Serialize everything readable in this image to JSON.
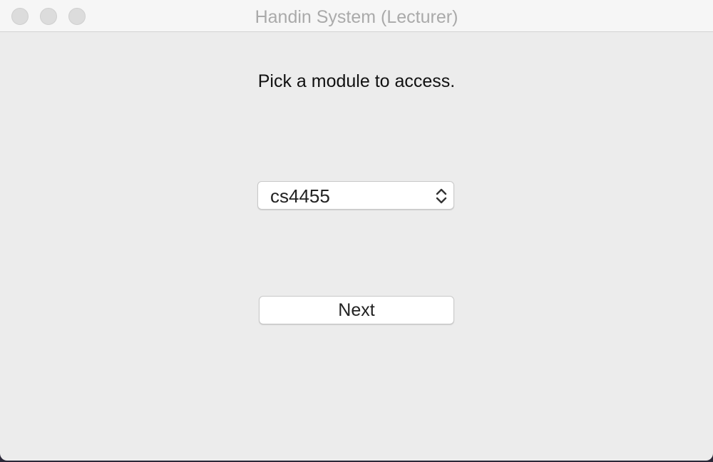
{
  "window": {
    "title": "Handin System (Lecturer)"
  },
  "main": {
    "prompt": "Pick a module to access.",
    "module_select": {
      "selected_value": "cs4455"
    },
    "next_label": "Next"
  },
  "icons": {
    "close": "close-icon",
    "minimize": "minimize-icon",
    "maximize": "maximize-icon",
    "select_arrows": "chevron-up-down-icon"
  },
  "colors": {
    "window_background": "#ececec",
    "titlebar_background": "#f6f6f6",
    "title_text": "#aaaaaa",
    "desktop_background": "#2b2838"
  }
}
